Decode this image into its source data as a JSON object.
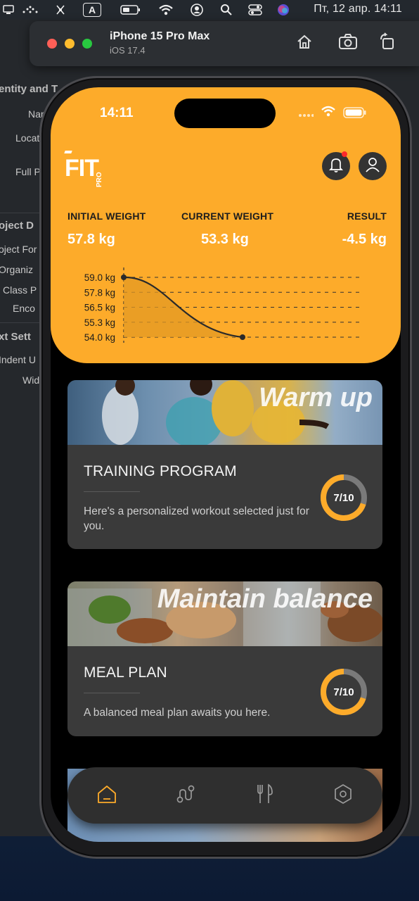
{
  "menubar": {
    "clock": "Пт, 12 апр.  14:11",
    "keyboard_layout": "A",
    "icons": [
      "monitor-icon",
      "bluetooth-dots-icon",
      "crossed-tool-icon",
      "keyboard-a-icon",
      "battery-icon",
      "wifi-icon",
      "user-circle-icon",
      "search-icon",
      "control-center-icon",
      "siri-icon"
    ]
  },
  "xcode": {
    "rows": [
      "entity and T",
      "Nar",
      "Locat",
      "Full P",
      "oject D",
      "oject For",
      "Organiz",
      "Class P",
      "Enco",
      "xt Sett",
      "Indent U",
      "Wid"
    ]
  },
  "simulator": {
    "title": "iPhone 15 Pro Max",
    "subtitle": "iOS 17.4",
    "buttons": [
      "home-icon",
      "screenshot-icon",
      "rotate-icon"
    ]
  },
  "status_bar": {
    "time": "14:11"
  },
  "logo": {
    "main": "FIT",
    "sub": "PRO"
  },
  "stats": {
    "initial_label": "INITIAL WEIGHT",
    "initial_value": "57.8 kg",
    "current_label": "CURRENT WEIGHT",
    "current_value": "53.3 kg",
    "result_label": "RESULT",
    "result_value": "-4.5 kg"
  },
  "chart_data": {
    "type": "area",
    "y_ticks": [
      "59.0 kg",
      "57.8 kg",
      "56.5 kg",
      "55.3 kg",
      "54.0 kg"
    ],
    "x": [
      0,
      1
    ],
    "y": [
      59.0,
      54.0
    ],
    "ylim": [
      54.0,
      59.0
    ],
    "grid": true,
    "accent": "#e39a24"
  },
  "cards": [
    {
      "tag": "Warm up",
      "title": "TRAINING PROGRAM",
      "desc": "Here's a personalized workout selected just for you.",
      "progress_text": "7/10",
      "progress": 0.7
    },
    {
      "tag": "Maintain balance",
      "title": "MEAL PLAN",
      "desc": "A balanced meal plan awaits you here.",
      "progress_text": "7/10",
      "progress": 0.7
    }
  ],
  "tabs": [
    {
      "name": "home-icon",
      "active": true
    },
    {
      "name": "route-icon",
      "active": false
    },
    {
      "name": "fork-knife-icon",
      "active": false
    },
    {
      "name": "settings-icon",
      "active": false
    }
  ],
  "colors": {
    "accent": "#fdab2a",
    "card": "#3a3a3a",
    "ring_track": "#7a7a7a"
  }
}
